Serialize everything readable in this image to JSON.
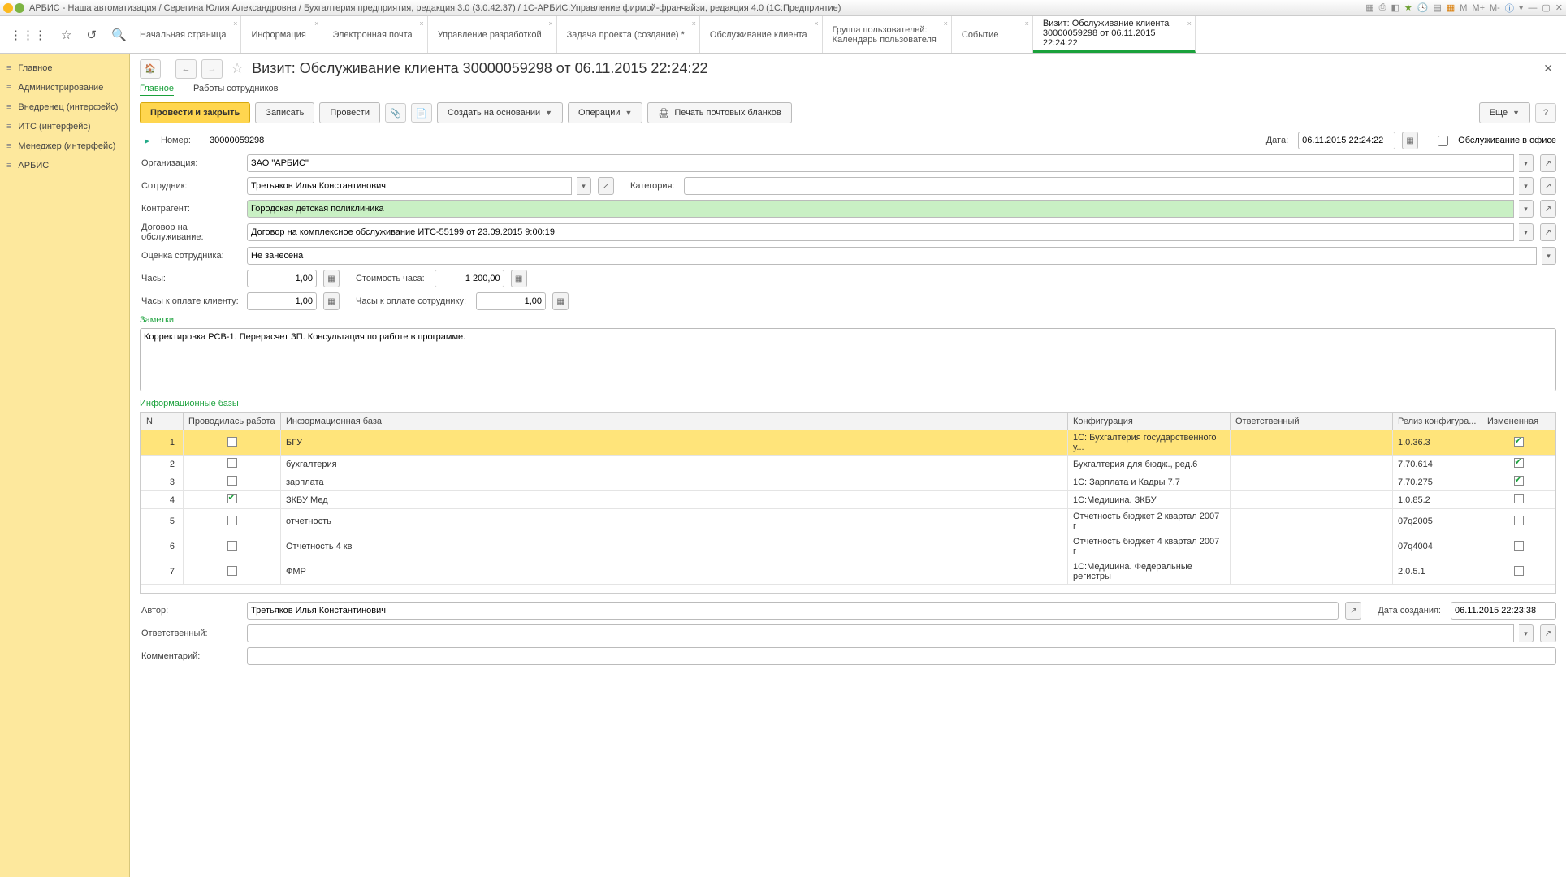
{
  "window_title": "АРБИС - Наша автоматизация / Серегина Юлия Александровна / Бухгалтерия предприятия, редакция 3.0 (3.0.42.37) / 1С-АРБИС:Управление фирмой-франчайзи, редакция 4.0  (1С:Предприятие)",
  "title_icons": {
    "m": "M",
    "mplus": "M+",
    "mminus": "M-"
  },
  "tabs": [
    {
      "label": "Начальная страница"
    },
    {
      "label": "Информация"
    },
    {
      "label": "Электронная почта"
    },
    {
      "label": "Управление разработкой"
    },
    {
      "label": "Задача проекта (создание) *"
    },
    {
      "label": "Обслуживание клиента"
    },
    {
      "label": "Группа пользователей:",
      "label2": "Календарь пользователя"
    },
    {
      "label": "Событие"
    },
    {
      "label": "Визит: Обслуживание клиента",
      "label2": "30000059298 от 06.11.2015 22:24:22",
      "active": true
    }
  ],
  "sidebar": [
    "Главное",
    "Администрирование",
    "Внедренец (интерфейс)",
    "ИТС (интерфейс)",
    "Менеджер (интерфейс)",
    "АРБИС"
  ],
  "page_title": "Визит: Обслуживание клиента 30000059298 от 06.11.2015 22:24:22",
  "subtabs": {
    "main": "Главное",
    "works": "Работы сотрудников"
  },
  "toolbar": {
    "post_close": "Провести и закрыть",
    "save": "Записать",
    "post": "Провести",
    "create_based": "Создать на основании",
    "operations": "Операции",
    "print_forms": "Печать почтовых бланков",
    "more": "Еще"
  },
  "fields": {
    "number_lbl": "Номер:",
    "number": "30000059298",
    "date_lbl": "Дата:",
    "date": "06.11.2015 22:24:22",
    "office_lbl": "Обслуживание в офисе",
    "org_lbl": "Организация:",
    "org": "ЗАО \"АРБИС\"",
    "emp_lbl": "Сотрудник:",
    "emp": "Третьяков Илья Константинович",
    "cat_lbl": "Категория:",
    "cat": "",
    "agent_lbl": "Контрагент:",
    "agent": "Городская детская поликлиника",
    "contract_lbl": "Договор на обслуживание:",
    "contract": "Договор на комплексное обслуживание ИТС-55199 от 23.09.2015 9:00:19",
    "rating_lbl": "Оценка сотрудника:",
    "rating": "Не занесена",
    "hours_lbl": "Часы:",
    "hours": "1,00",
    "hour_cost_lbl": "Стоимость часа:",
    "hour_cost": "1 200,00",
    "hours_client_lbl": "Часы к оплате клиенту:",
    "hours_client": "1,00",
    "hours_emp_lbl": "Часы к оплате сотруднику:",
    "hours_emp": "1,00",
    "notes_title": "Заметки",
    "notes": "Корректировка РСВ-1. Перерасчет ЗП. Консультация по работе в программе.",
    "bases_title": "Информационные базы",
    "author_lbl": "Автор:",
    "author": "Третьяков Илья Константинович",
    "created_lbl": "Дата создания:",
    "created": "06.11.2015 22:23:38",
    "resp_lbl": "Ответственный:",
    "resp": "",
    "comment_lbl": "Комментарий:",
    "comment": ""
  },
  "grid": {
    "headers": {
      "n": "N",
      "worked": "Проводилась работа",
      "base": "Информационная база",
      "config": "Конфигурация",
      "resp": "Ответственный",
      "release": "Релиз конфигура...",
      "changed": "Измененная"
    },
    "rows": [
      {
        "n": 1,
        "worked": false,
        "base": "БГУ",
        "config": "1С: Бухгалтерия государственного у...",
        "resp": "",
        "release": "1.0.36.3",
        "changed": true,
        "sel": true
      },
      {
        "n": 2,
        "worked": false,
        "base": "бухгалтерия",
        "config": "Бухгалтерия для бюдж., ред.6",
        "resp": "",
        "release": "7.70.614",
        "changed": true
      },
      {
        "n": 3,
        "worked": false,
        "base": "зарплата",
        "config": "1С: Зарплата и Кадры 7.7",
        "resp": "",
        "release": "7.70.275",
        "changed": true
      },
      {
        "n": 4,
        "worked": true,
        "base": "ЗКБУ Мед",
        "config": "1С:Медицина. ЗКБУ",
        "resp": "",
        "release": "1.0.85.2",
        "changed": false
      },
      {
        "n": 5,
        "worked": false,
        "base": "отчетность",
        "config": "Отчетность бюджет 2 квартал 2007 г",
        "resp": "",
        "release": "07q2005",
        "changed": false
      },
      {
        "n": 6,
        "worked": false,
        "base": "Отчетность 4 кв",
        "config": "Отчетность бюджет 4 квартал 2007 г",
        "resp": "",
        "release": "07q4004",
        "changed": false
      },
      {
        "n": 7,
        "worked": false,
        "base": "ФМР",
        "config": "1С:Медицина. Федеральные регистры",
        "resp": "",
        "release": "2.0.5.1",
        "changed": false
      }
    ]
  }
}
